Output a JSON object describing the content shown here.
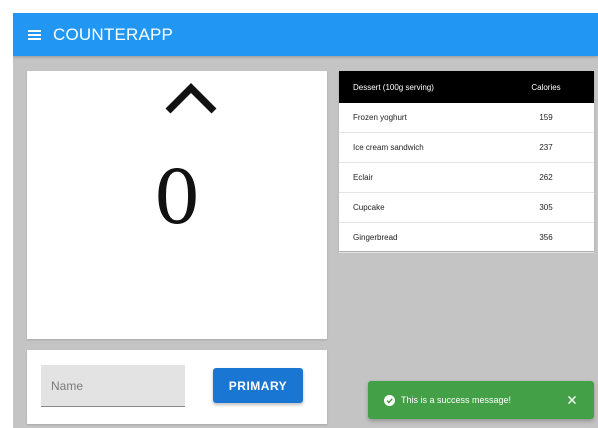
{
  "app": {
    "title": "COUNTERAPP"
  },
  "counter": {
    "value": "0"
  },
  "table": {
    "headers": {
      "dessert": "Dessert (100g serving)",
      "calories": "Calories"
    },
    "rows": [
      {
        "name": "Frozen yoghurt",
        "calories": "159"
      },
      {
        "name": "Ice cream sandwich",
        "calories": "237"
      },
      {
        "name": "Eclair",
        "calories": "262"
      },
      {
        "name": "Cupcake",
        "calories": "305"
      },
      {
        "name": "Gingerbread",
        "calories": "356"
      }
    ]
  },
  "form": {
    "name_placeholder": "Name",
    "name_value": "",
    "primary_label": "PRIMARY"
  },
  "snackbar": {
    "message": "This is a success message!"
  },
  "icons": {
    "menu": "menu-icon",
    "up_arrow": "chevron-up-icon",
    "success": "check-circle-icon",
    "close": "close-icon"
  },
  "colors": {
    "appbar": "#2196f3",
    "primary_button": "#1976d2",
    "success": "#43a047",
    "background": "#c4c4c4",
    "table_header": "#000000"
  }
}
